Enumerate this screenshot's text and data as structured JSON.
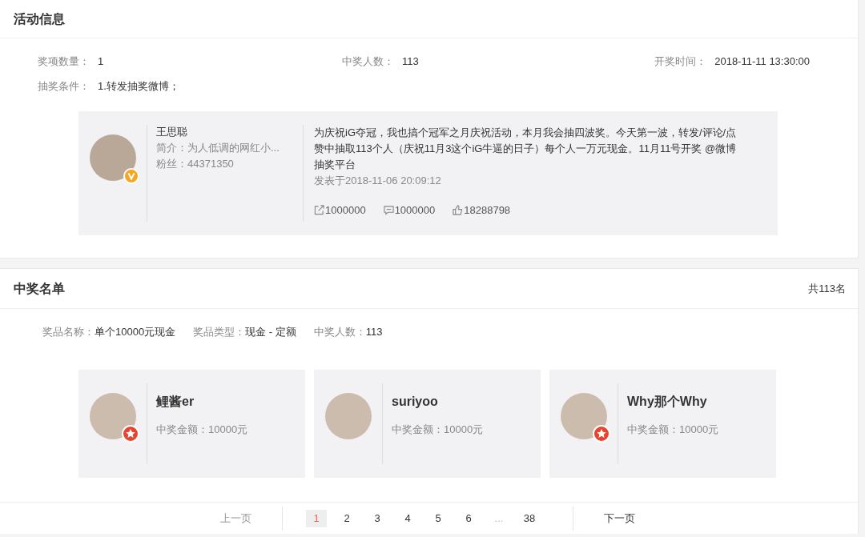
{
  "activity": {
    "title": "活动信息",
    "fields": [
      {
        "label": "奖项数量：",
        "value": "1"
      },
      {
        "label": "中奖人数：",
        "value": "113"
      },
      {
        "label": "开奖时间：",
        "value": "2018-11-11 13:30:00"
      }
    ],
    "condition": {
      "label": "抽奖条件：",
      "value": "1.转发抽奖微博；"
    },
    "post": {
      "author": "王思聪",
      "verified": true,
      "bio": "简介：为人低调的网红小...",
      "fans": "粉丝：44371350",
      "text": "为庆祝iG夺冠，我也搞个冠军之月庆祝活动，本月我会抽四波奖。今天第一波，转发/评论/点赞中抽取113个人（庆祝11月3这个iG牛逼的日子）每个人一万元现金。11月11号开奖 @微博抽奖平台",
      "time": "发表于2018-11-06 20:09:12",
      "stats": [
        {
          "kind": "repost",
          "value": "1000000"
        },
        {
          "kind": "comment",
          "value": "1000000"
        },
        {
          "kind": "like",
          "value": "18288798"
        }
      ]
    }
  },
  "winners": {
    "title": "中奖名单",
    "total": "共113名",
    "prize": [
      {
        "label": "奖品名称：",
        "value": "单个10000元现金"
      },
      {
        "label": "奖品类型：",
        "value": "现金 - 定额"
      },
      {
        "label": "中奖人数：",
        "value": "113"
      }
    ],
    "items": [
      {
        "name": "鲤酱er",
        "starred": true,
        "amount": "中奖金额：10000元"
      },
      {
        "name": "suriyoo",
        "starred": false,
        "amount": "中奖金额：10000元"
      },
      {
        "name": "Why那个Why",
        "starred": true,
        "amount": "中奖金额：10000元"
      }
    ],
    "pagination": {
      "prev": {
        "label": "上一页",
        "disabled": true
      },
      "pages": [
        {
          "label": "1",
          "kind": "page",
          "selected": true
        },
        {
          "label": "2",
          "kind": "page",
          "selected": false
        },
        {
          "label": "3",
          "kind": "page",
          "selected": false
        },
        {
          "label": "4",
          "kind": "page",
          "selected": false
        },
        {
          "label": "5",
          "kind": "page",
          "selected": false
        },
        {
          "label": "6",
          "kind": "page",
          "selected": false
        },
        {
          "label": "...",
          "kind": "ellipsis"
        },
        {
          "label": "38",
          "kind": "page",
          "selected": false
        }
      ],
      "next": {
        "label": "下一页",
        "disabled": false
      }
    }
  }
}
